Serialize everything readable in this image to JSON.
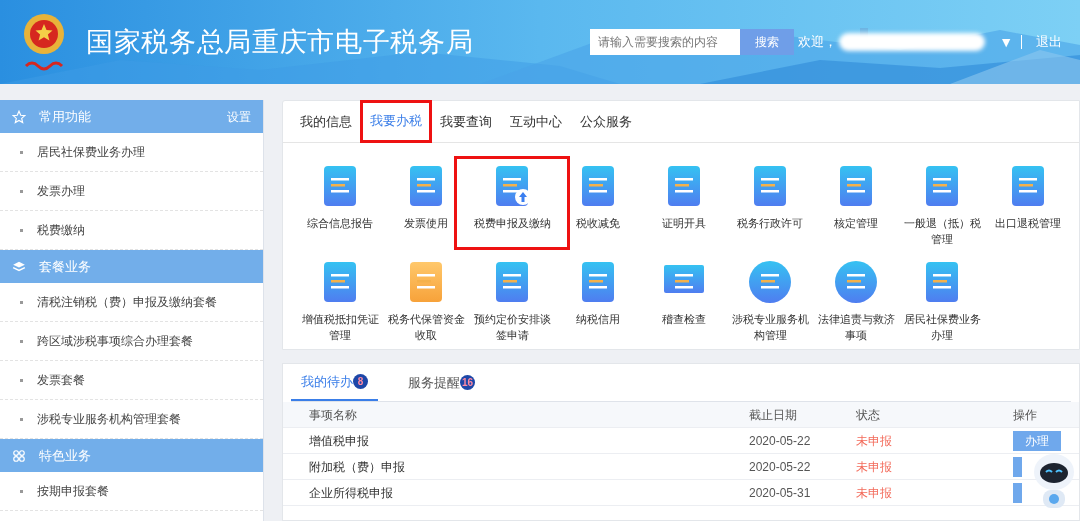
{
  "header": {
    "title": "国家税务总局重庆市电子税务局",
    "search": {
      "placeholder": "请输入需要搜索的内容",
      "button": "搜索"
    },
    "welcome": "欢迎，",
    "user_menu": "▼",
    "logout": "退出"
  },
  "sidebar": {
    "sections": [
      {
        "title": "常用功能",
        "action": "设置",
        "items": [
          "居民社保费业务办理",
          "发票办理",
          "税费缴纳"
        ]
      },
      {
        "title": "套餐业务",
        "items": [
          "清税注销税（费）申报及缴纳套餐",
          "跨区域涉税事项综合办理套餐",
          "发票套餐",
          "涉税专业服务机构管理套餐"
        ]
      },
      {
        "title": "特色业务",
        "items": [
          "按期申报套餐"
        ]
      }
    ]
  },
  "main": {
    "tabs": [
      {
        "label": "我的信息",
        "selected": false,
        "highlighted": false
      },
      {
        "label": "我要办税",
        "selected": true,
        "highlighted": true
      },
      {
        "label": "我要查询",
        "selected": false,
        "highlighted": false
      },
      {
        "label": "互动中心",
        "selected": false,
        "highlighted": false
      },
      {
        "label": "公众服务",
        "selected": false,
        "highlighted": false
      }
    ],
    "services": [
      {
        "label": "综合信息报告",
        "highlighted": false
      },
      {
        "label": "发票使用",
        "highlighted": false
      },
      {
        "label": "税费申报及缴纳",
        "highlighted": true
      },
      {
        "label": "税收减免",
        "highlighted": false
      },
      {
        "label": "证明开具",
        "highlighted": false
      },
      {
        "label": "税务行政许可",
        "highlighted": false
      },
      {
        "label": "核定管理",
        "highlighted": false
      },
      {
        "label": "一般退（抵）税管理",
        "highlighted": false
      },
      {
        "label": "出口退税管理",
        "highlighted": false
      },
      {
        "label": "增值税抵扣凭证管理",
        "highlighted": false
      },
      {
        "label": "税务代保管资金收取",
        "highlighted": false
      },
      {
        "label": "预约定价安排谈签申请",
        "highlighted": false
      },
      {
        "label": "纳税信用",
        "highlighted": false
      },
      {
        "label": "稽查检查",
        "highlighted": false
      },
      {
        "label": "涉税专业服务机构管理",
        "highlighted": false
      },
      {
        "label": "法律追责与救济事项",
        "highlighted": false
      },
      {
        "label": "居民社保费业务办理",
        "highlighted": false
      }
    ]
  },
  "todo": {
    "tabs": [
      {
        "label": "我的待办",
        "count": "8",
        "selected": true
      },
      {
        "label": "服务提醒",
        "count": "16",
        "selected": false
      }
    ],
    "columns": [
      "事项名称",
      "截止日期",
      "状态",
      "操作"
    ],
    "rows": [
      {
        "name": "增值税申报",
        "deadline": "2020-05-22",
        "status": "未申报",
        "action": "办理"
      },
      {
        "name": "附加税（费）申报",
        "deadline": "2020-05-22",
        "status": "未申报"
      },
      {
        "name": "企业所得税申报",
        "deadline": "2020-05-31",
        "status": "未申报"
      }
    ]
  }
}
